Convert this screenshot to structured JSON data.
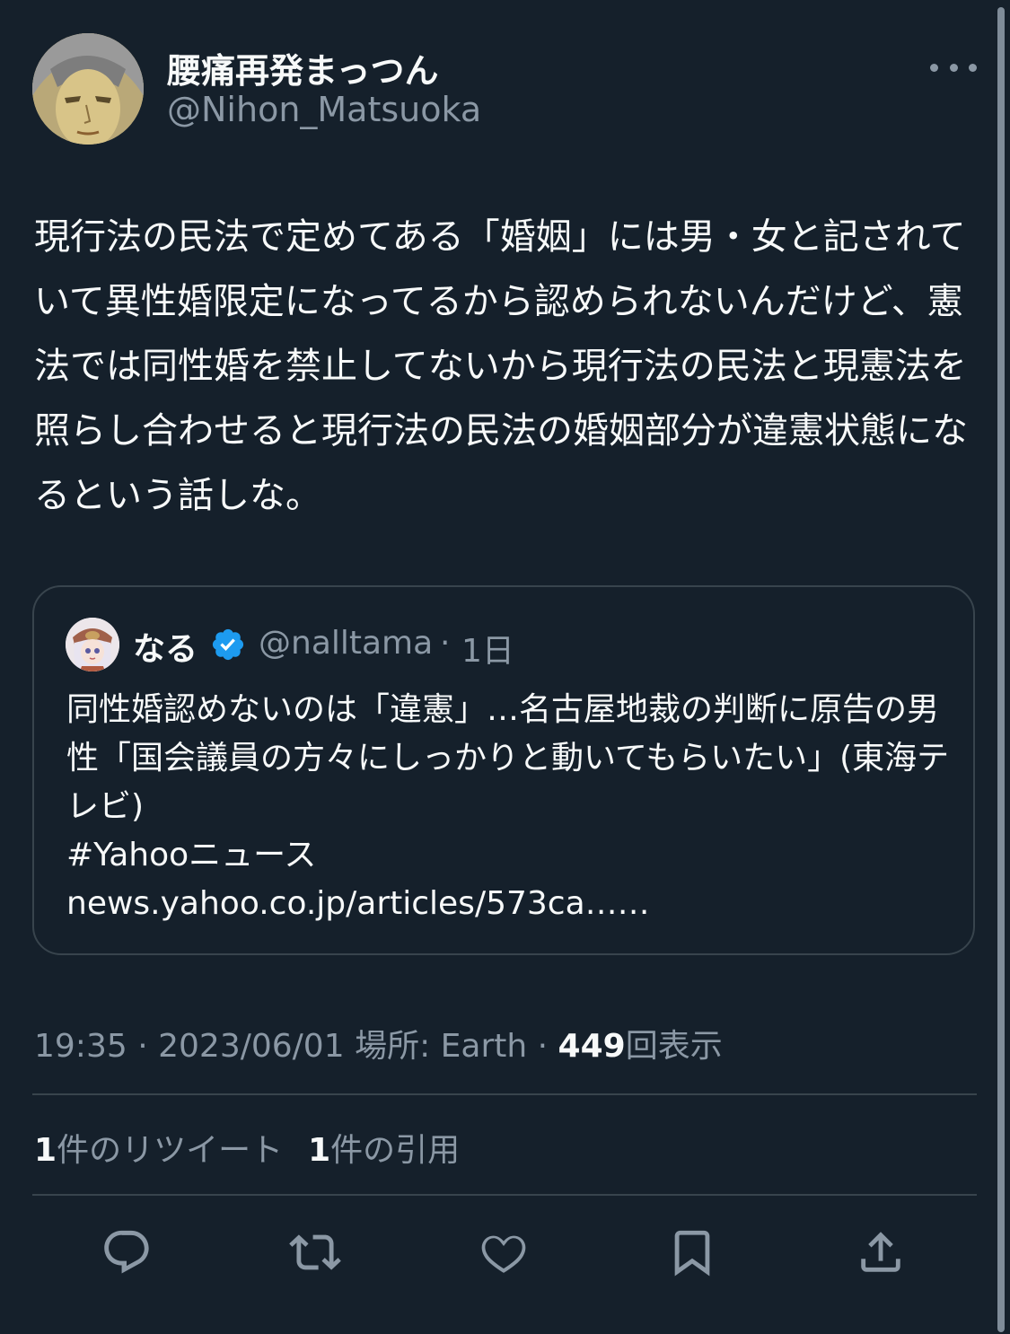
{
  "author": {
    "display_name": "腰痛再発まっつん",
    "handle": "@Nihon_Matsuoka",
    "avatar_icon": "anime-character-avatar-icon"
  },
  "tweet": {
    "text": "現行法の民法で定めてある「婚姻」には男・女と記されていて異性婚限定になってるから認められないんだけど、憲法では同性婚を禁止してないから現行法の民法と現憲法を照らし合わせると現行法の民法の婚姻部分が違憲状態になるという話しな。"
  },
  "quote": {
    "display_name": "なる",
    "handle": "@nalltama",
    "separator": "·",
    "age": "1日",
    "verified_color": "#1d9bf0",
    "text": "同性婚認めないのは「違憲」…名古屋地裁の判断に原告の男性「国会議員の方々にしっかりと動いてもらいたい」(東海テレビ)\n#Yahooニュース\nnews.yahoo.co.jp/articles/573ca……"
  },
  "meta": {
    "time": "19:35",
    "sep1": "·",
    "date": "2023/06/01",
    "location_label": "場所: Earth",
    "sep2": "·",
    "views_count": "449",
    "views_label": "回表示"
  },
  "stats": {
    "retweets_count": "1",
    "retweets_label": "件のリツイート",
    "quotes_count": "1",
    "quotes_label": "件の引用"
  },
  "actions": [
    "reply-icon",
    "retweet-icon",
    "like-icon",
    "bookmark-icon",
    "share-icon"
  ],
  "colors": {
    "background": "#15202b",
    "primary_text": "#f7f9f9",
    "secondary_text": "#8b98a5",
    "border": "#38444d",
    "accent": "#1d9bf0"
  }
}
